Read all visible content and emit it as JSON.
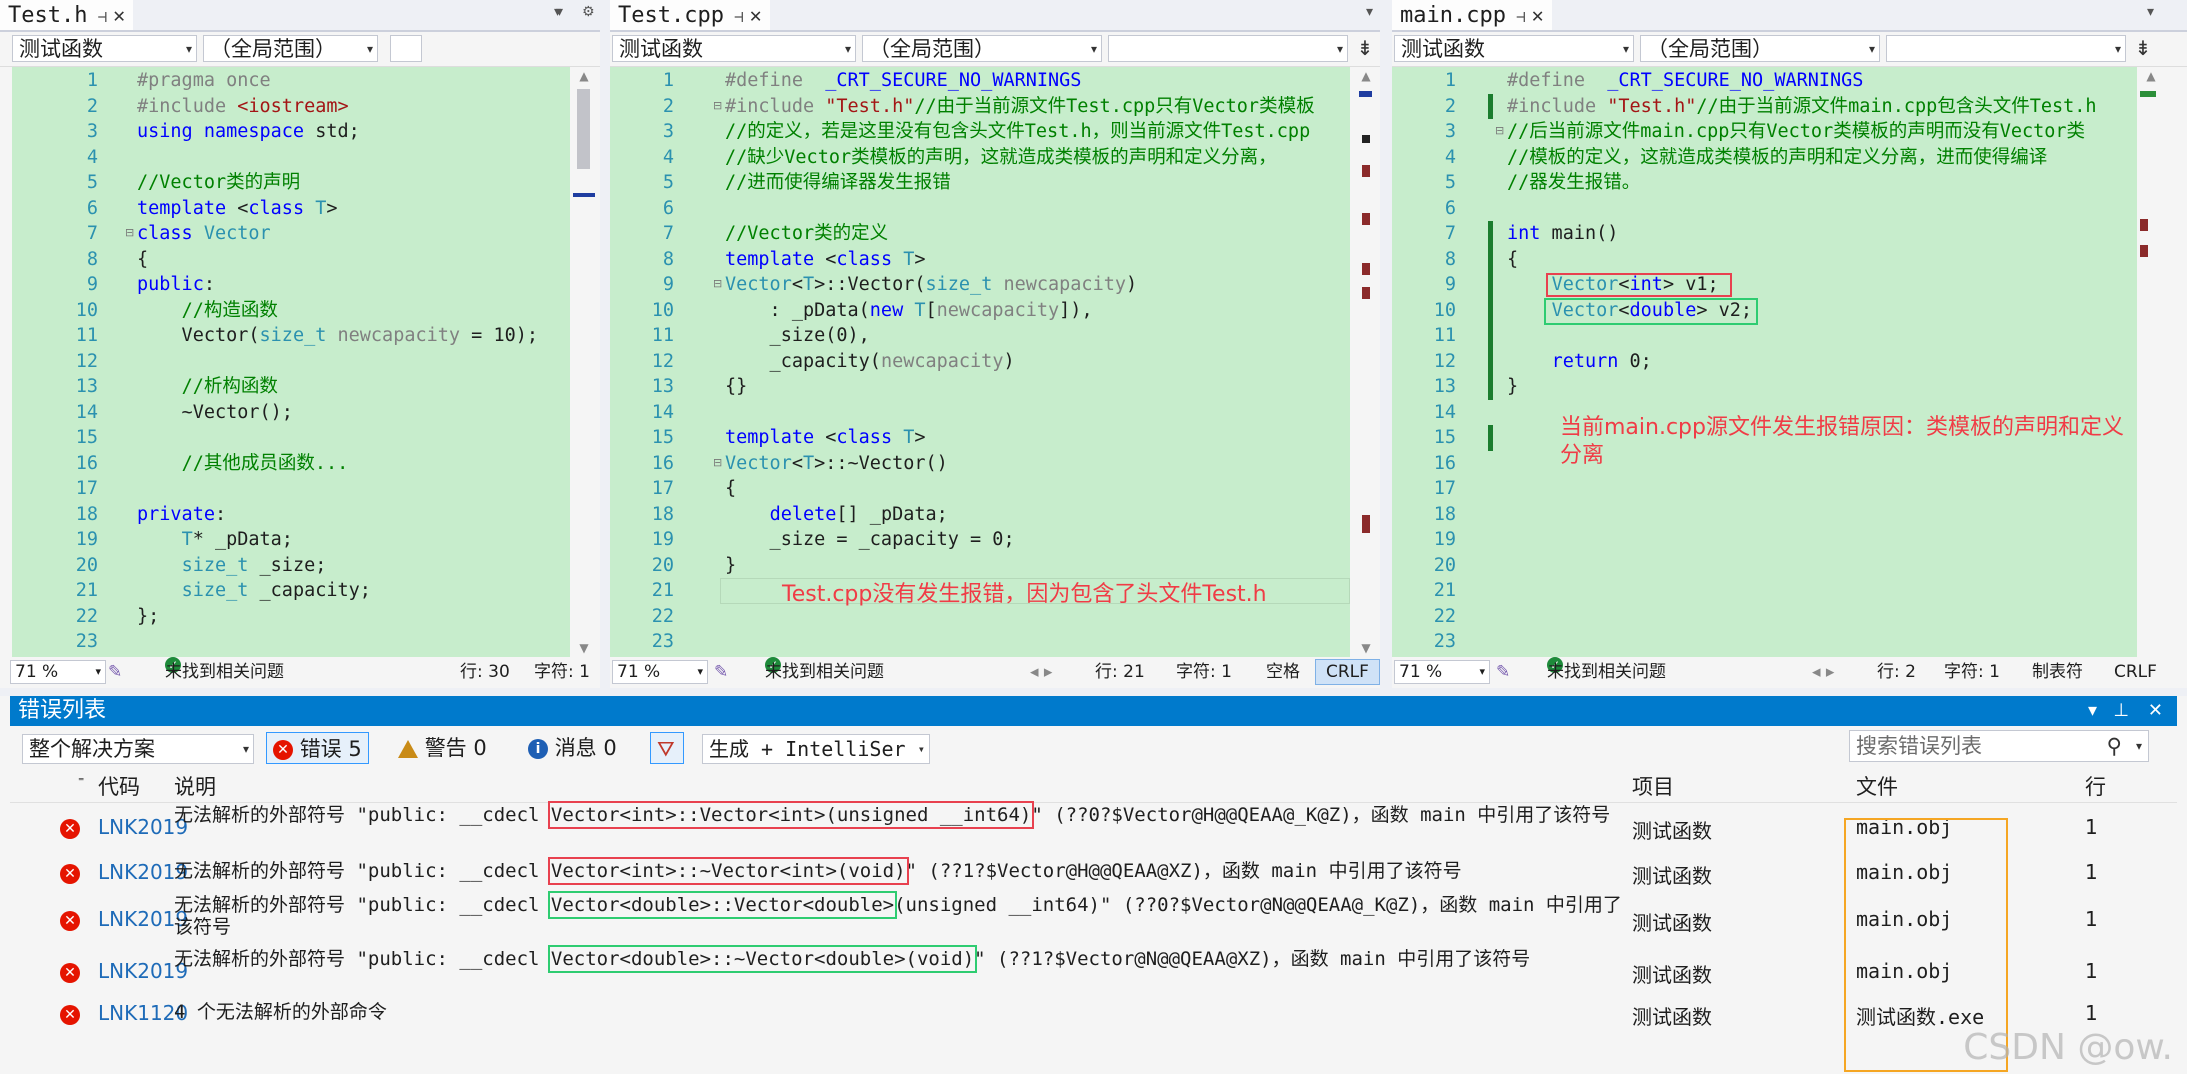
{
  "colors": {
    "editor_bg": "#c7edcc",
    "accent": "#007acc",
    "error": "#e51400",
    "annotation": "#f03c46",
    "highlight_red": "#e8414f",
    "highlight_green": "#2ecc71",
    "highlight_orange": "#f5a623"
  },
  "panes": [
    {
      "tab": "Test.h",
      "nav_func": "测试函数",
      "nav_scope": "（全局范围）",
      "zoom": "71 %",
      "issues": "未找到相关问题",
      "row": "行: 30",
      "col": "字符: 1"
    },
    {
      "tab": "Test.cpp",
      "nav_func": "测试函数",
      "nav_scope": "（全局范围）",
      "zoom": "71 %",
      "issues": "未找到相关问题",
      "row": "行: 21",
      "col": "字符: 1",
      "space": "空格",
      "eol": "CRLF",
      "annotation": "Test.cpp没有发生报错，因为包含了头文件Test.h"
    },
    {
      "tab": "main.cpp",
      "nav_func": "测试函数",
      "nav_scope": "（全局范围）",
      "zoom": "71 %",
      "issues": "未找到相关问题",
      "row": "行: 2",
      "col": "字符: 1",
      "tabs": "制表符",
      "eol": "CRLF",
      "annotation": "当前main.cpp源文件发生报错原因：类模板的声明和定义分离"
    }
  ],
  "error_list": {
    "title": "错误列表",
    "scope": "整个解决方案",
    "errors_btn": "错误 5",
    "warnings_btn": "警告 0",
    "messages_btn": "消息 0",
    "build_filter": "生成 + IntelliSer",
    "search_placeholder": "搜索错误列表",
    "col_code": "代码",
    "col_desc": "说明",
    "col_project": "项目",
    "col_file": "文件",
    "col_line": "行",
    "rows": [
      {
        "code": "LNK2019",
        "desc_pre": "无法解析的外部符号 \"public: __cdecl ",
        "desc_hl": "Vector<int>::Vector<int>(unsigned __int64)",
        "desc_post": "\" (??0?$Vector@H@@QEAA@_K@Z)，函数 main 中引用了该符号",
        "project": "测试函数",
        "file": "main.obj",
        "line": "1"
      },
      {
        "code": "LNK2019",
        "desc_pre": "无法解析的外部符号 \"public: __cdecl ",
        "desc_hl": "Vector<int>::~Vector<int>(void)",
        "desc_post": "\" (??1?$Vector@H@@QEAA@XZ)，函数 main 中引用了该符号",
        "project": "测试函数",
        "file": "main.obj",
        "line": "1"
      },
      {
        "code": "LNK2019",
        "desc_pre": "无法解析的外部符号 \"public: __cdecl ",
        "desc_hl": "Vector<double>::Vector<double>",
        "desc_post": "(unsigned __int64)\" (??0?$Vector@N@@QEAA@_K@Z)，函数 main 中引用了该符号",
        "project": "测试函数",
        "file": "main.obj",
        "line": "1"
      },
      {
        "code": "LNK2019",
        "desc_pre": "无法解析的外部符号 \"public: __cdecl ",
        "desc_hl": "Vector<double>::~Vector<double>(void)",
        "desc_post": "\" (??1?$Vector@N@@QEAA@XZ)，函数 main 中引用了该符号",
        "project": "测试函数",
        "file": "main.obj",
        "line": "1"
      },
      {
        "code": "LNK1120",
        "desc_pre": "4 个无法解析的外部命令",
        "desc_hl": "",
        "desc_post": "",
        "project": "测试函数",
        "file": "测试函数.exe",
        "line": "1"
      }
    ]
  },
  "watermark": "CSDN @ow."
}
